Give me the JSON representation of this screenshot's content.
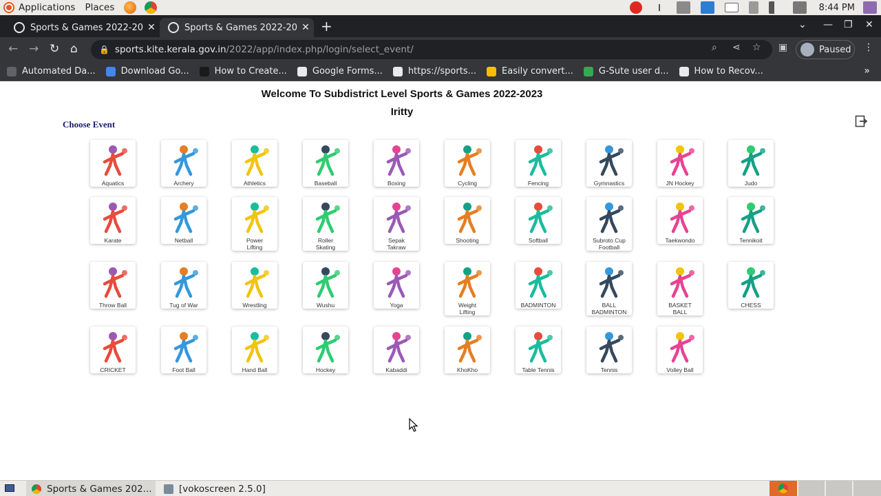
{
  "os": {
    "menu_applications": "Applications",
    "menu_places": "Places",
    "clock": "8:44 PM",
    "taskbar": [
      {
        "label": "Sports & Games 202...",
        "icon": "chrome-icon"
      },
      {
        "label": "[vokoscreen 2.5.0]",
        "icon": "vokoscreen-icon"
      }
    ]
  },
  "browser": {
    "tabs": [
      {
        "title": "Sports & Games 2022-202",
        "active": false
      },
      {
        "title": "Sports & Games  2022-202",
        "active": true
      }
    ],
    "url_host": "sports.kite.kerala.gov.in",
    "url_path": "/2022/app/index.php/login/select_event/",
    "profile_status": "Paused",
    "bookmarks": [
      {
        "label": "Automated Da...",
        "color": "#5f6368"
      },
      {
        "label": "Download Go...",
        "color": "#4285f4"
      },
      {
        "label": "How to Create...",
        "color": "#1a1a1a"
      },
      {
        "label": "Google Forms...",
        "color": "#e8eaed"
      },
      {
        "label": "https://sports...",
        "color": "#e8eaed"
      },
      {
        "label": "Easily convert...",
        "color": "#fbbc04"
      },
      {
        "label": "G-Sute user d...",
        "color": "#34a853"
      },
      {
        "label": "How to Recov...",
        "color": "#e8eaed"
      }
    ]
  },
  "page": {
    "welcome": "Welcome To Subdistrict Level Sports & Games 2022-2023",
    "subdistrict": "Iritty",
    "choose_event": "Choose Event",
    "events": [
      [
        [
          "Aquatics"
        ],
        [
          "Archery"
        ],
        [
          "Athletics"
        ],
        [
          "Baseball"
        ],
        [
          "Boxing"
        ],
        [
          "Cycling"
        ],
        [
          "Fencing"
        ],
        [
          "Gymnastics"
        ],
        [
          "JN Hockey"
        ],
        [
          "Judo"
        ]
      ],
      [
        [
          "Karate"
        ],
        [
          "Netball"
        ],
        [
          "Power",
          "Lifting"
        ],
        [
          "Roller",
          "Skating"
        ],
        [
          "Sepak",
          "Takraw"
        ],
        [
          "Shooting"
        ],
        [
          "Softball"
        ],
        [
          "Subroto Cup",
          "Football"
        ],
        [
          "Taekwondo"
        ],
        [
          "Tennikoit"
        ]
      ],
      [
        [
          "Throw Ball"
        ],
        [
          "Tug of War"
        ],
        [
          "Wrestling"
        ],
        [
          "Wushu"
        ],
        [
          "Yoga"
        ],
        [
          "Weight",
          "Lifting"
        ],
        [
          "BADMINTON"
        ],
        [
          "BALL",
          "BADMINTON"
        ],
        [
          "BASKET",
          "BALL"
        ],
        [
          "CHESS"
        ]
      ],
      [
        [
          "CRICKET"
        ],
        [
          "Foot Ball"
        ],
        [
          "Hand Ball"
        ],
        [
          "Hockey"
        ],
        [
          "Kabaddi"
        ],
        [
          "KhoKho"
        ],
        [
          "Table Tennis"
        ],
        [
          "Tennis"
        ],
        [
          "Volley Ball"
        ]
      ]
    ]
  }
}
